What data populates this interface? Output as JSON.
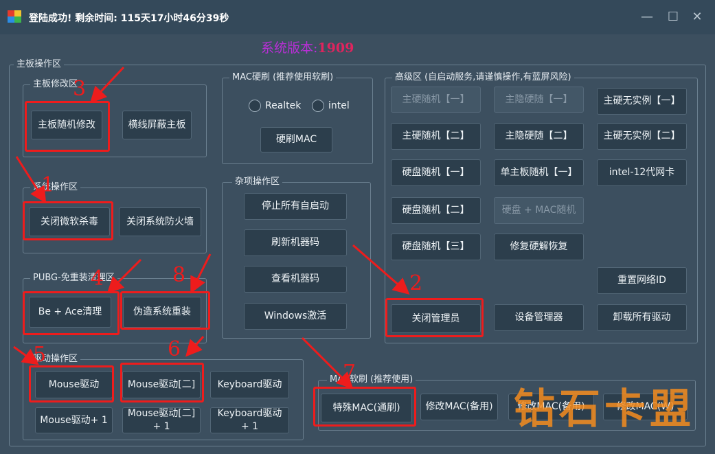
{
  "window": {
    "title": "登陆成功! 剩余时间: 115天17小时46分39秒",
    "controls": {
      "minimize": "—",
      "maximize": "☐",
      "close": "✕"
    }
  },
  "version": {
    "label": "系统版本:",
    "number": "1909"
  },
  "mainboard_area": {
    "legend": "主板操作区",
    "mainboard_modify": {
      "legend": "主板修改区",
      "buttons": [
        "主板随机修改",
        "横线屏蔽主板"
      ]
    },
    "system_ops": {
      "legend": "系统操作区",
      "buttons": [
        "关闭微软杀毒",
        "关闭系统防火墙"
      ]
    },
    "pubg": {
      "legend": "PUBG-免重装清理区",
      "buttons": [
        "Be + Ace清理",
        "伪造系统重装"
      ]
    },
    "driver_ops": {
      "legend": "驱动操作区",
      "buttons": [
        "Mouse驱动",
        "Mouse驱动[二]",
        "Keyboard驱动",
        "Mouse驱动+ 1",
        "Mouse驱动[二] + 1",
        "Keyboard驱动 + 1"
      ]
    }
  },
  "mac_hard": {
    "legend": "MAC硬刷 (推荐使用软刷)",
    "radios": [
      "Realtek",
      "intel"
    ],
    "button": "硬刷MAC"
  },
  "misc": {
    "legend": "杂项操作区",
    "buttons": [
      "停止所有自启动",
      "刷新机器码",
      "查看机器码",
      "Windows激活"
    ]
  },
  "advanced": {
    "legend": "高级区 (自启动服务,请谨慎操作,有蓝屏风险)",
    "buttons": [
      "主硬随机【一】",
      "主隐硬随【一】",
      "主硬无实例【一】",
      "主硬随机【二】",
      "主隐硬随【二】",
      "主硬无实例【二】",
      "硬盘随机【一】",
      "单主板随机【一】",
      "intel-12代网卡",
      "硬盘随机【二】",
      "硬盘 + MAC随机",
      "硬盘随机【三】",
      "修复硬解恢复",
      "重置网络ID",
      "关闭管理员",
      "设备管理器",
      "卸载所有驱动"
    ]
  },
  "mac_soft": {
    "legend": "MAC软刷 (推荐使用)",
    "buttons": [
      "特殊MAC(通刷)",
      "修改MAC(备用)",
      "修改MAC(备用)",
      "修改MAC(W)"
    ]
  },
  "annotations": [
    "1",
    "2",
    "3",
    "4",
    "5",
    "6",
    "7",
    "8"
  ],
  "watermark": "钻石卡盟",
  "colors": {
    "background": "#3c4f5f",
    "button": "#2c3e4c",
    "highlight": "#ee1c1c",
    "version_label": "#b92fd6",
    "version_number": "#e0245e",
    "watermark": "#f38c20"
  }
}
